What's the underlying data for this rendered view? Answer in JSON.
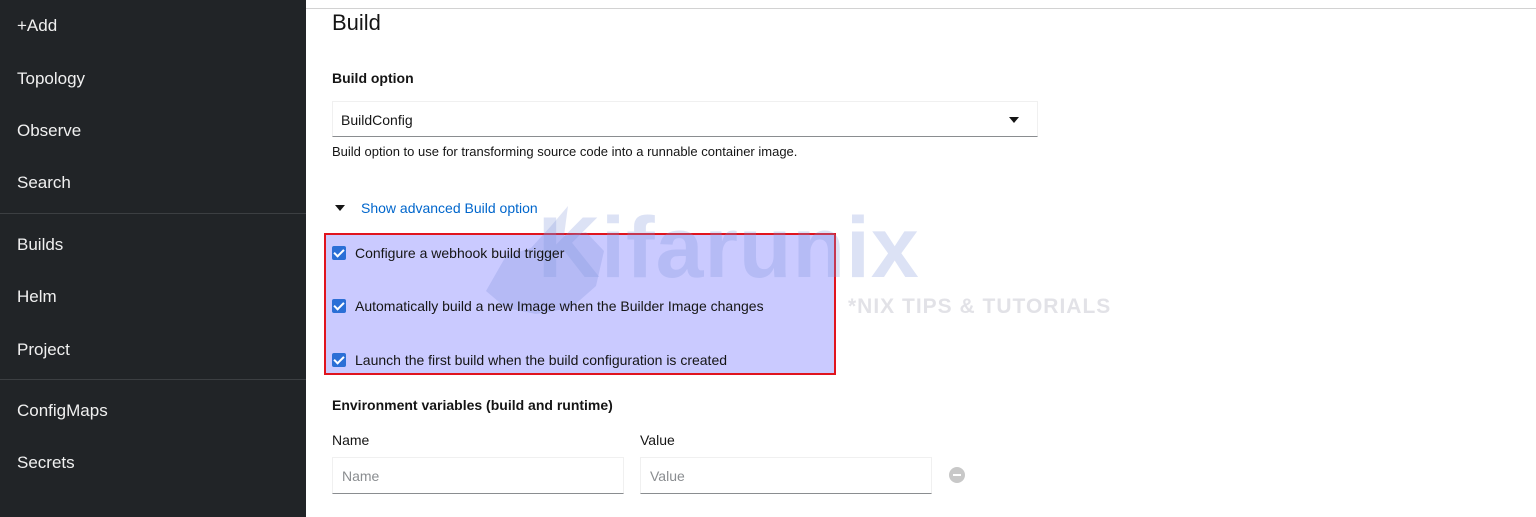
{
  "sidebar": {
    "items": [
      {
        "label": "+Add"
      },
      {
        "label": "Topology"
      },
      {
        "label": "Observe"
      },
      {
        "label": "Search"
      },
      {
        "label": "Builds"
      },
      {
        "label": "Helm"
      },
      {
        "label": "Project"
      },
      {
        "label": "ConfigMaps"
      },
      {
        "label": "Secrets"
      }
    ]
  },
  "build": {
    "title": "Build",
    "option_label": "Build option",
    "option_value": "BuildConfig",
    "option_helper": "Build option to use for transforming source code into a runnable container image.",
    "advanced_toggle": "Show advanced Build option",
    "checkboxes": [
      {
        "label": "Configure a webhook build trigger",
        "checked": true
      },
      {
        "label": "Automatically build a new Image when the Builder Image changes",
        "checked": true
      },
      {
        "label": "Launch the first build when the build configuration is created",
        "checked": true
      }
    ]
  },
  "env": {
    "title": "Environment variables (build and runtime)",
    "name_label": "Name",
    "value_label": "Value",
    "name_placeholder": "Name",
    "value_placeholder": "Value"
  },
  "watermark": {
    "logo_text": "Kifarunix",
    "tagline": "*NIX TIPS & TUTORIALS"
  },
  "colors": {
    "sidebar_bg": "#212427",
    "link": "#0066cc",
    "checkbox": "#2b6fd6",
    "highlight_border": "#e0141e"
  }
}
